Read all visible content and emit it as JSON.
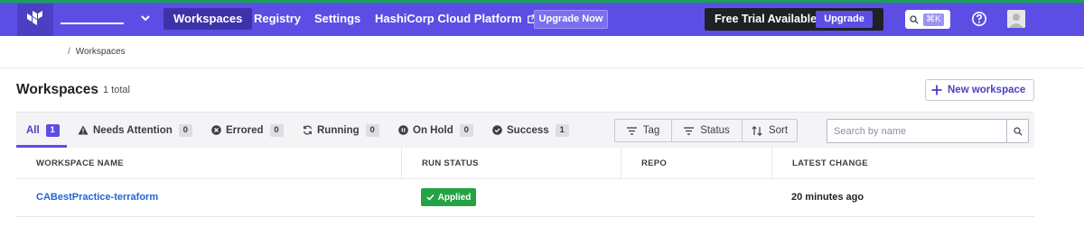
{
  "nav": {
    "links": [
      "Workspaces",
      "Registry",
      "Settings",
      "HashiCorp Cloud Platform"
    ],
    "upgrade_now": "Upgrade Now",
    "trial_text": "Free Trial Available",
    "trial_upgrade": "Upgrade",
    "search_shortcut": "⌘K"
  },
  "breadcrumb": {
    "separator": "/",
    "current": "Workspaces"
  },
  "page": {
    "title": "Workspaces",
    "total": "1 total",
    "new_workspace": "New workspace"
  },
  "tabs": [
    {
      "label": "All",
      "count": "1"
    },
    {
      "label": "Needs Attention",
      "count": "0"
    },
    {
      "label": "Errored",
      "count": "0"
    },
    {
      "label": "Running",
      "count": "0"
    },
    {
      "label": "On Hold",
      "count": "0"
    },
    {
      "label": "Success",
      "count": "1"
    }
  ],
  "filters": {
    "tag": "Tag",
    "status": "Status",
    "sort": "Sort"
  },
  "search": {
    "placeholder": "Search by name",
    "value": ""
  },
  "table": {
    "headers": [
      "WORKSPACE NAME",
      "RUN STATUS",
      "REPO",
      "LATEST CHANGE"
    ],
    "rows": [
      {
        "name": "CABestPractice-terraform",
        "status": "Applied",
        "repo": "",
        "latest_change": "20 minutes ago"
      }
    ]
  },
  "colors": {
    "brand": "#5c4ee5",
    "success": "#25a244",
    "link": "#2264d6"
  }
}
